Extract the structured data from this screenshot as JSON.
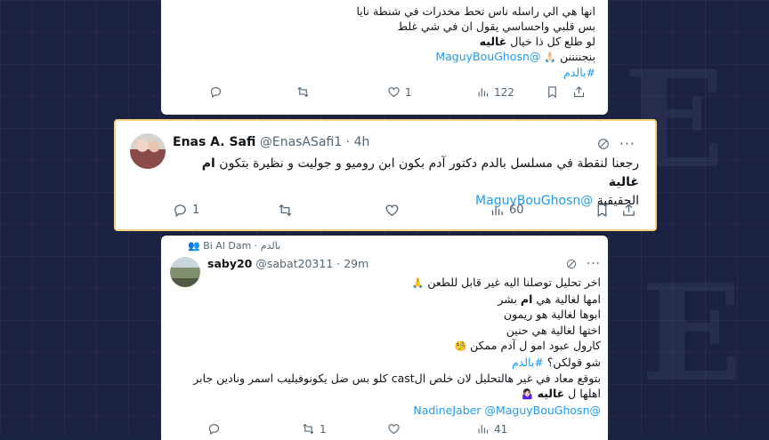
{
  "top_tweet": {
    "lines": [
      "انها هي الي راسله ناس تحط مخدرات في شنطة نايا",
      "بس قلبي واحساسي يقول ان في شي غلط"
    ],
    "line3_text": "لو طلع كل ذا خيال",
    "line3_bold": "غاليه",
    "line4_text": "بنجننننن",
    "line4_emoji": "🙏🏻",
    "mention": "@MaguyBouGhosn",
    "hashtag": "#بالدم",
    "like_count": "1",
    "view_count": "122",
    "icons": [
      "reply-icon",
      "retweet-icon",
      "like-icon",
      "views-icon",
      "bookmark-icon",
      "share-icon"
    ]
  },
  "mid_tweet": {
    "name": "Enas A. Safi",
    "handle": "@EnasASafi1",
    "time": "· 4h",
    "text_main": "رجعنا لنقطة في مسلسل بالدم دكتور آدم بكون ابن روميو و جوليت و نظيرة بتكون",
    "text_bold": "ام غالية",
    "text_line2": "الحقيقية",
    "mention": "@MaguyBouGhosn",
    "reply_count": "1",
    "view_count": "60",
    "border_color": "#f3d27a"
  },
  "bot_tweet": {
    "retweet_label": "Bi Al Dam · بالدم",
    "name": "saby20",
    "handle": "@sabat20311",
    "time": "· 29m",
    "lines": [
      {
        "text": "اخر تحليل توصلنا اليه غير قابل للطعن",
        "emoji": "🙏"
      },
      {
        "text": "امها لغالية هي",
        "bold": "ام",
        "tail": "بشر"
      },
      {
        "text": "ابوها لغالية هو ريمون"
      },
      {
        "text": "اختها لغالية هي حنين"
      },
      {
        "text": "كارول عبود امو ل آدم ممكن",
        "emoji": "🧐"
      },
      {
        "text": "شو قولكن؟",
        "hashtag": "#بالدم"
      },
      {
        "text": "بتوقع معاد في غير هالتحليل لان خلص الcast كلو بس ضل يكونوفيليب اسمر ونادين جابر"
      },
      {
        "text": "اهلها ل",
        "bold": "غاليه",
        "emoji": "🤷🏻‍♀️"
      }
    ],
    "mentions": "@NadineJaber @MaguyBouGhosn",
    "count_a": "1",
    "count_b": "41"
  },
  "colors": {
    "link": "#1d9bf0",
    "muted": "#536471",
    "background": "#1b2140"
  }
}
